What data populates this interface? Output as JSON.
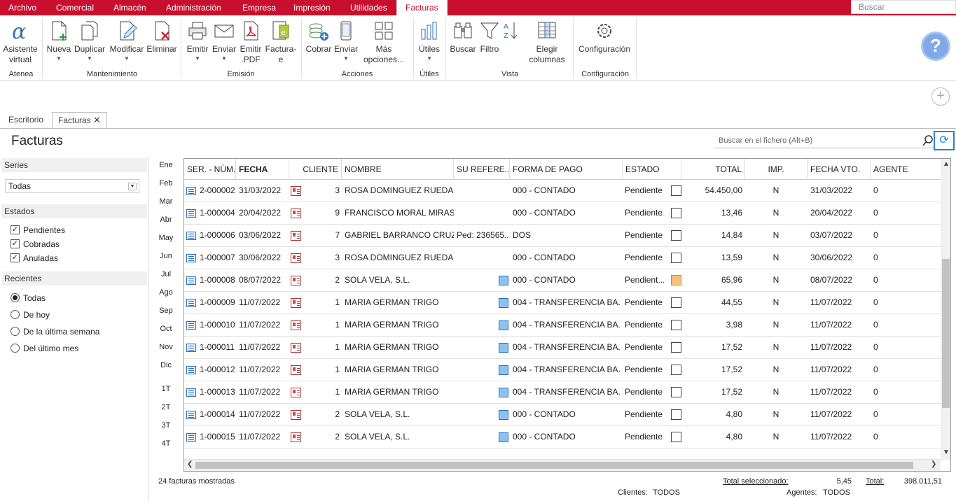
{
  "menu": {
    "items": [
      "Archivo",
      "Comercial",
      "Almacén",
      "Administración",
      "Empresa",
      "Impresión",
      "Utilidades",
      "Facturas"
    ],
    "search_placeholder": "Buscar"
  },
  "ribbon": {
    "buttons": {
      "asistente": "Asistente virtual",
      "nueva": "Nueva",
      "duplicar": "Duplicar",
      "modificar": "Modificar",
      "eliminar": "Eliminar",
      "emitir": "Emitir",
      "enviar": "Enviar",
      "emitir_pdf": "Emitir .PDF",
      "facturae": "Factura-e",
      "cobrar": "Cobrar",
      "enviar2": "Enviar",
      "mas": "Más opciones...",
      "utiles": "Útiles",
      "buscar": "Buscar",
      "filtro": "Filtro",
      "elegir": "Elegir columnas",
      "config": "Configuración"
    },
    "groups": {
      "atenea": "Atenea",
      "mantenimiento": "Mantenimiento",
      "emision": "Emisión",
      "acciones": "Acciones",
      "utiles": "Útiles",
      "vista": "Vista",
      "configuracion": "Configuración"
    }
  },
  "tabs": {
    "escritorio": "Escritorio",
    "facturas": "Facturas"
  },
  "page": {
    "title": "Facturas",
    "search_placeholder": "Buscar en el fichero (Alt+B)"
  },
  "sidebar": {
    "series_label": "Series",
    "series_value": "Todas",
    "estados_label": "Estados",
    "estados": [
      "Pendientes",
      "Cobradas",
      "Anuladas"
    ],
    "recientes_label": "Recientes",
    "recientes": [
      "Todas",
      "De hoy",
      "De la última semana",
      "Del último mes"
    ]
  },
  "months": [
    "Ene",
    "Feb",
    "Mar",
    "Abr",
    "May",
    "Jun",
    "Jul",
    "Ago",
    "Sep",
    "Oct",
    "Nov",
    "Dic",
    "1T",
    "2T",
    "3T",
    "4T"
  ],
  "table": {
    "columns": [
      "SER. - NÚM.",
      "FECHA",
      "CLIENTE",
      "NOMBRE",
      "SU REFERE...",
      "FORMA DE PAGO",
      "ESTADO",
      "TOTAL",
      "IMP.",
      "FECHA VTO.",
      "AGENTE"
    ],
    "rows": [
      {
        "num": "2-000002",
        "fecha": "31/03/2022",
        "cliente": "3",
        "nombre": "ROSA DOMINGUEZ RUEDA",
        "ref": "",
        "forma": "000 - CONTADO",
        "estado": "Pendiente",
        "total": "54.450,00",
        "imp": "N",
        "vto": "31/03/2022",
        "agente": "0"
      },
      {
        "num": "1-000004",
        "fecha": "20/04/2022",
        "cliente": "9",
        "nombre": "FRANCISCO MORAL MIRAS",
        "ref": "",
        "forma": "000 - CONTADO",
        "estado": "Pendiente",
        "total": "13,46",
        "imp": "N",
        "vto": "20/04/2022",
        "agente": "0"
      },
      {
        "num": "1-000006",
        "fecha": "03/06/2022",
        "cliente": "7",
        "nombre": "GABRIEL BARRANCO CRUZ",
        "ref": "Ped: 236565...",
        "forma": "DOS",
        "estado": "Pendiente",
        "total": "14,84",
        "imp": "N",
        "vto": "03/07/2022",
        "agente": "0"
      },
      {
        "num": "1-000007",
        "fecha": "30/06/2022",
        "cliente": "3",
        "nombre": "ROSA DOMINGUEZ RUEDA",
        "ref": "",
        "forma": "000 - CONTADO",
        "estado": "Pendiente",
        "total": "13,59",
        "imp": "N",
        "vto": "30/06/2022",
        "agente": "0"
      },
      {
        "num": "1-000008",
        "fecha": "08/07/2022",
        "cliente": "2",
        "nombre": "SOLA VELA, S.L.",
        "ref": "",
        "forma": "000 - CONTADO",
        "estado": "Pendient...",
        "total": "65,96",
        "imp": "N",
        "vto": "08/07/2022",
        "agente": "0"
      },
      {
        "num": "1-000009",
        "fecha": "11/07/2022",
        "cliente": "1",
        "nombre": "MARIA GERMAN TRIGO",
        "ref": "",
        "forma": "004 - TRANSFERENCIA BA...",
        "estado": "Pendiente",
        "total": "44,55",
        "imp": "N",
        "vto": "11/07/2022",
        "agente": "0"
      },
      {
        "num": "1-000010",
        "fecha": "11/07/2022",
        "cliente": "1",
        "nombre": "MARIA GERMAN TRIGO",
        "ref": "",
        "forma": "004 - TRANSFERENCIA BA...",
        "estado": "Pendiente",
        "total": "3,98",
        "imp": "N",
        "vto": "11/07/2022",
        "agente": "0"
      },
      {
        "num": "1-000011",
        "fecha": "11/07/2022",
        "cliente": "1",
        "nombre": "MARIA GERMAN TRIGO",
        "ref": "",
        "forma": "004 - TRANSFERENCIA BA...",
        "estado": "Pendiente",
        "total": "17,52",
        "imp": "N",
        "vto": "11/07/2022",
        "agente": "0"
      },
      {
        "num": "1-000012",
        "fecha": "11/07/2022",
        "cliente": "1",
        "nombre": "MARIA GERMAN TRIGO",
        "ref": "",
        "forma": "004 - TRANSFERENCIA BA...",
        "estado": "Pendiente",
        "total": "17,52",
        "imp": "N",
        "vto": "11/07/2022",
        "agente": "0"
      },
      {
        "num": "1-000013",
        "fecha": "11/07/2022",
        "cliente": "1",
        "nombre": "MARIA GERMAN TRIGO",
        "ref": "",
        "forma": "004 - TRANSFERENCIA BA...",
        "estado": "Pendiente",
        "total": "17,52",
        "imp": "N",
        "vto": "11/07/2022",
        "agente": "0"
      },
      {
        "num": "1-000014",
        "fecha": "11/07/2022",
        "cliente": "2",
        "nombre": "SOLA VELA, S.L.",
        "ref": "",
        "forma": "000 - CONTADO",
        "estado": "Pendiente",
        "total": "4,80",
        "imp": "N",
        "vto": "11/07/2022",
        "agente": "0"
      },
      {
        "num": "1-000015",
        "fecha": "11/07/2022",
        "cliente": "2",
        "nombre": "SOLA VELA, S.L.",
        "ref": "",
        "forma": "000 - CONTADO",
        "estado": "Pendiente",
        "total": "4,80",
        "imp": "N",
        "vto": "11/07/2022",
        "agente": "0"
      }
    ]
  },
  "footer": {
    "shown": "24 facturas mostradas",
    "total_sel_label": "Total seleccionado:",
    "total_sel_value": "5,45",
    "total_label": "Total:",
    "total_value": "398.011,51",
    "clientes_label": "Clientes:",
    "clientes_value": "TODOS",
    "agentes_label": "Agentes:",
    "agentes_value": "TODOS"
  },
  "colors": {
    "brand": "#c8102e",
    "accent": "#2a7fd6"
  }
}
